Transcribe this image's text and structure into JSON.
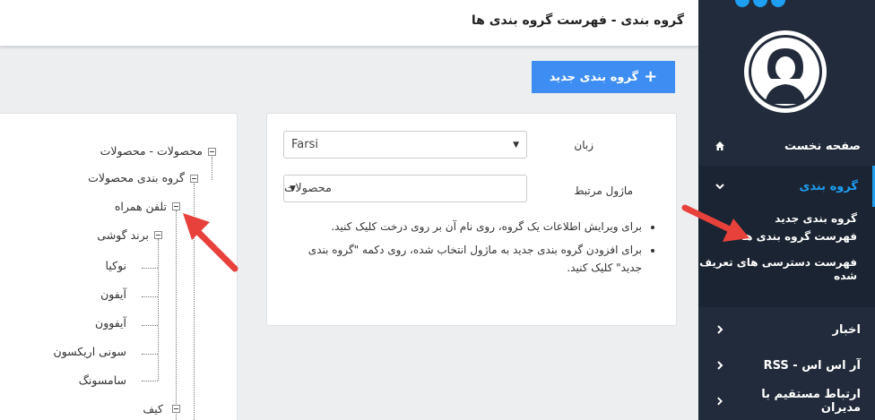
{
  "header": {
    "title": "گروه بندی - فهرست گروه بندی ها"
  },
  "toolbar": {
    "new_group_label": "گروه بندی جدید",
    "new_group_icon": "plus-icon"
  },
  "form": {
    "language_label": "زبان",
    "language_value": "Farsi",
    "module_label": "ماژول مرتبط",
    "module_value": "محصولات",
    "notes": [
      "برای ویرایش اطلاعات یک گروه، روی نام آن بر روی درخت کلیک کنید.",
      "برای افزودن گروه بندی جدید به ماژول انتخاب شده، روی دکمه \"گروه بندی جدید\" کلیک کنید."
    ]
  },
  "tree": {
    "root": "محصولات - محصولات",
    "level1": "گروه بندی محصولات",
    "level2": "تلفن همراه",
    "level3": "برند گوشی",
    "brands": [
      "نوکیا",
      "آیفون",
      "آیفوون",
      "سونی اریکسون",
      "سامسونگ"
    ],
    "sibling": "کیف"
  },
  "sidebar": {
    "home": "صفحه نخست",
    "group": "گروه بندی",
    "submenu": [
      "گروه بندی جدید",
      "فهرست گروه بندی ها",
      "فهرست دسترسی های تعریف شده"
    ],
    "news": "اخبار",
    "rss": "آر اس اس - RSS",
    "contact": "ارتباط مستقیم با مدیران"
  },
  "colors": {
    "accent": "#1e9ff2",
    "button": "#3d8df2",
    "sidebar_bg": "#222b3b",
    "arrow": "#e8413c"
  }
}
